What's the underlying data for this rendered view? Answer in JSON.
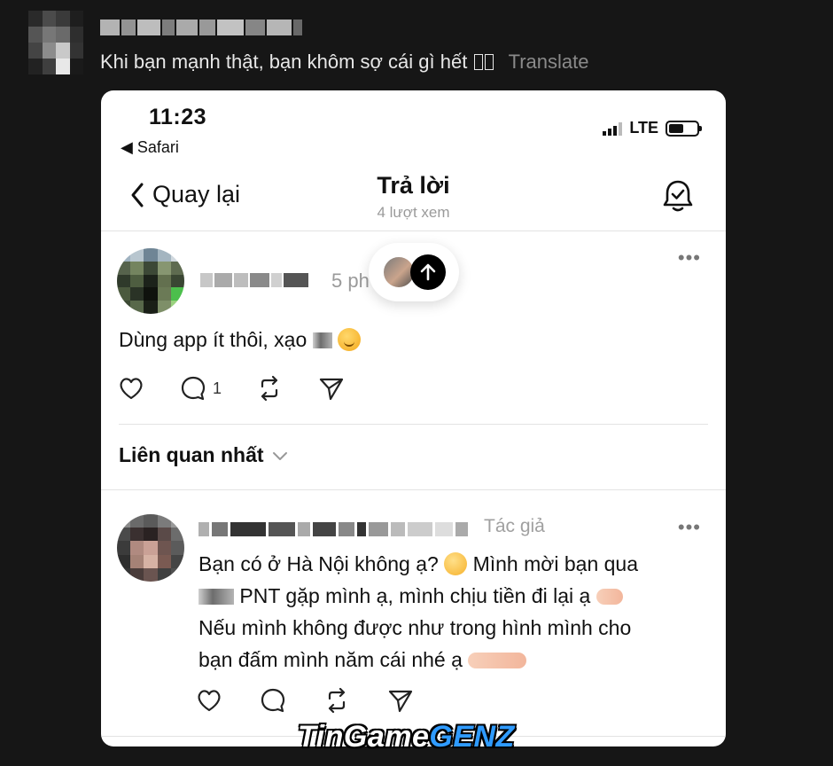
{
  "outer": {
    "caption": "Khi bạn mạnh thật, bạn khôm sợ cái gì hết",
    "caption_glyphs": "",
    "translate_label": "Translate"
  },
  "status_bar": {
    "time": "11:23",
    "back_app": "◀ Safari",
    "network": "LTE"
  },
  "nav": {
    "back_label": "Quay lại",
    "title": "Trả lời",
    "views": "4 lượt xem"
  },
  "post": {
    "time": "5 ph",
    "text_before": "Dùng app ít thôi, xạo ",
    "reply_count": "1",
    "more": "•••"
  },
  "sort": {
    "label": "Liên quan nhất"
  },
  "reply": {
    "author_tag": "Tác giả",
    "more": "•••",
    "line1_a": "Bạn có ở Hà Nội không ạ? ",
    "line1_b": " Mình mời bạn qua",
    "line2": " PNT gặp mình ạ, mình chịu tiền đi lại ạ ",
    "line3": "Nếu mình không được như trong hình mình cho",
    "line4": "bạn đấm mình năm cái nhé ạ "
  },
  "watermark": {
    "part1": "TinGame",
    "part2": "GENZ"
  }
}
